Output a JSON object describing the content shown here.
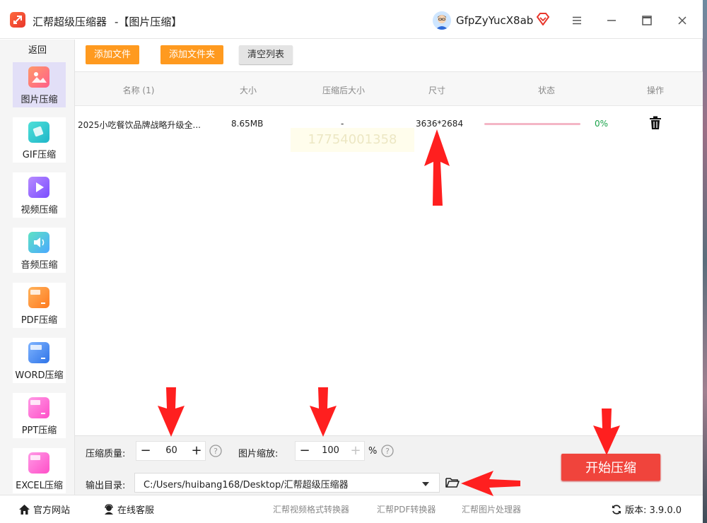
{
  "app": {
    "title": "汇帮超级压缩器",
    "subtitle": "-【图片压缩】",
    "username": "GfpZyYucX8ab"
  },
  "colors": {
    "accent_orange": "#ff9a1f",
    "start_red": "#f0443c",
    "progress_pink": "#f4b6c6",
    "status_green": "#1aa34a",
    "sidebar_active": "#e2dff7"
  },
  "sidebar": {
    "back_label": "返回",
    "items": [
      {
        "label": "图片压缩",
        "icon": "image-icon",
        "active": true
      },
      {
        "label": "GIF压缩",
        "icon": "gif-icon",
        "active": false
      },
      {
        "label": "视频压缩",
        "icon": "video-play-icon",
        "active": false
      },
      {
        "label": "音频压缩",
        "icon": "audio-icon",
        "active": false
      },
      {
        "label": "PDF压缩",
        "icon": "pdf-file-icon",
        "active": false
      },
      {
        "label": "WORD压缩",
        "icon": "word-file-icon",
        "active": false
      },
      {
        "label": "PPT压缩",
        "icon": "ppt-file-icon",
        "active": false
      },
      {
        "label": "EXCEL压缩",
        "icon": "excel-file-icon",
        "active": false
      }
    ]
  },
  "toolbar": {
    "add_file": "添加文件",
    "add_folder": "添加文件夹",
    "clear_list": "清空列表"
  },
  "table": {
    "headers": {
      "name": "名称 (1)",
      "size": "大小",
      "compressed_size": "压缩后大小",
      "dimensions": "尺寸",
      "status": "状态",
      "action": "操作"
    },
    "rows": [
      {
        "name": "2025小吃餐饮品牌战略升级全...",
        "size": "8.65MB",
        "compressed_size": "-",
        "dimensions": "3636*2684",
        "progress": 0,
        "progress_text": "0%"
      }
    ]
  },
  "settings": {
    "quality_label": "压缩质量:",
    "quality_value": "60",
    "scale_label": "图片缩放:",
    "scale_value": "100",
    "scale_unit": "%",
    "output_label": "输出目录:",
    "output_path": "C:/Users/huibang168/Desktop/汇帮超级压缩器",
    "start_button": "开始压缩"
  },
  "statusbar": {
    "website": "官方网站",
    "support": "在线客服",
    "link1": "汇帮视频格式转换器",
    "link2": "汇帮PDF转换器",
    "link3": "汇帮图片处理器",
    "version_label": "版本:",
    "version_value": "3.9.0.0"
  }
}
